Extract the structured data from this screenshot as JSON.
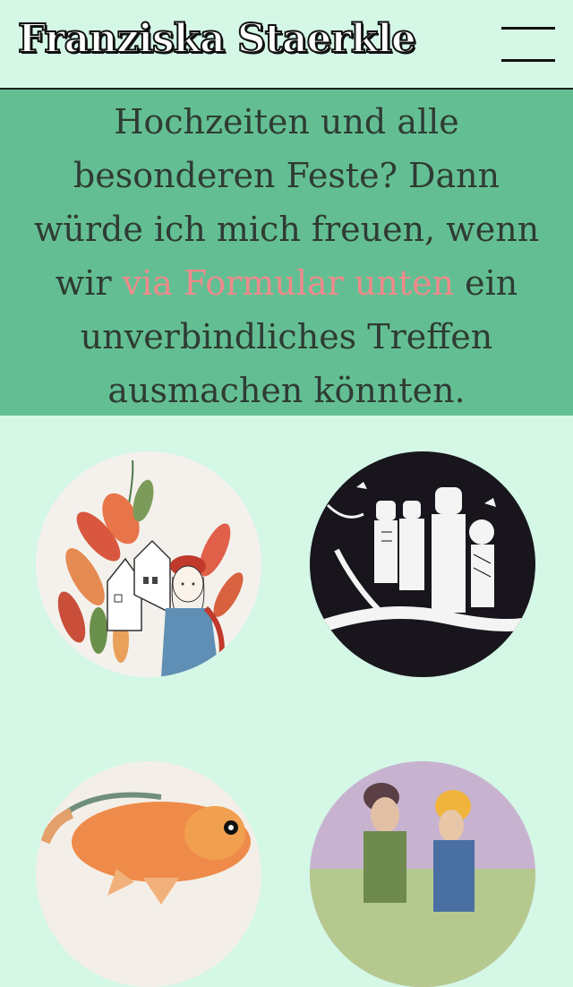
{
  "header": {
    "title": "Franziska Staerkle",
    "menu_icon": "hamburger-menu-icon"
  },
  "intro": {
    "text_before": "Hochzeiten und alle besonderen Feste? Dann würde ich mich freuen, wenn wir ",
    "link_text": "via Formular unten",
    "text_after": " ein unverbindliches Treffen ausmachen könnten."
  },
  "colors": {
    "header_bg": "#d4f7e6",
    "intro_bg": "#63bf93",
    "intro_text": "#2f3b33",
    "link": "#f08a8a"
  },
  "gallery": [
    {
      "subject": "illustration-girl-with-plants"
    },
    {
      "subject": "illustration-people-on-branch"
    },
    {
      "subject": "illustration-goldfish"
    },
    {
      "subject": "illustration-two-figures"
    }
  ]
}
